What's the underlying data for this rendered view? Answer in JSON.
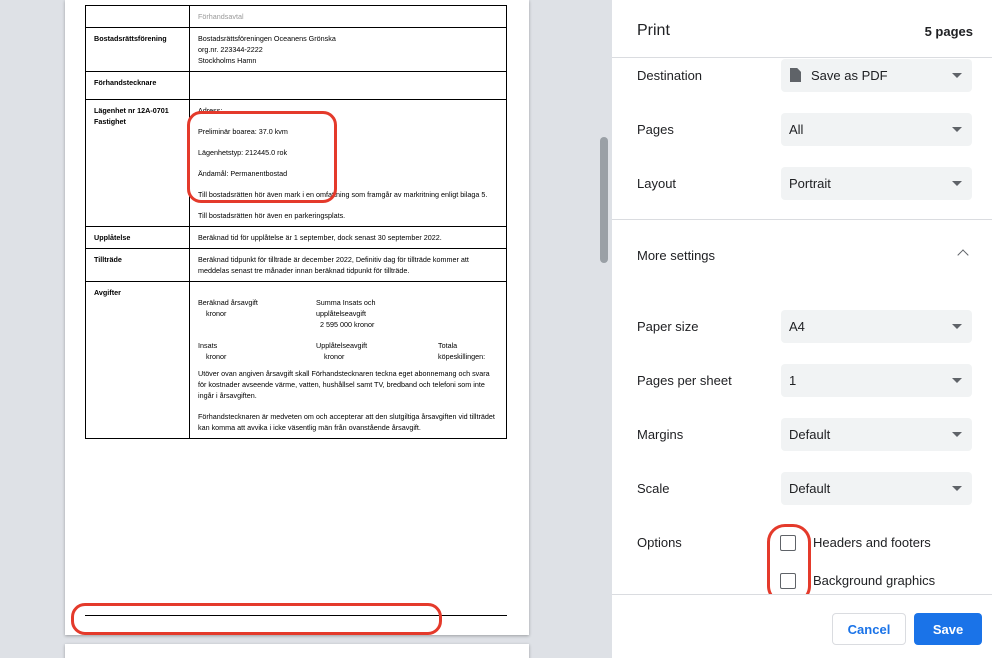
{
  "document": {
    "header_note": "Förhandsavtal",
    "rows": {
      "association": {
        "label": "Bostadsrättsförening",
        "line1": "Bostadsrättsföreningen Oceanens Grönska",
        "line2": "org.nr. 223344-2222",
        "line3": "Stockholms Hamn"
      },
      "subscriber": {
        "label": "Förhandstecknare"
      },
      "apartment": {
        "label1": "Lägenhet nr 12A-0701",
        "label2": "Fastighet",
        "address": "Adress:",
        "area": "Preliminär boarea:   37.0   kvm",
        "type": "Lägenhetstyp:   212445.0   rok",
        "purpose": "Ändamål: Permanentbostad",
        "land_note": "Till bostadsrätten hör även mark i en omfattning som framgår av markritning enligt bilaga 5.",
        "parking_note": "Till bostadsrätten hör även en parkeringsplats."
      },
      "grant": {
        "label": "Upplåtelse",
        "text": "Beräknad tid för upplåtelse är 1 september, dock senast 30 september 2022."
      },
      "access": {
        "label": "Tillträde",
        "text": "Beräknad tidpunkt för tillträde är december 2022, Definitiv dag för tillträde kommer att meddelas senast tre månader innan beräknad tidpunkt för tillträde."
      },
      "fees": {
        "label": "Avgifter",
        "annual_fee": "Beräknad årsavgift",
        "annual_fee_unit": "kronor",
        "sum_insats_1": "Summa Insats och",
        "sum_insats_2": "upplåtelseavgift",
        "sum_insats_value": "2 595 000  kronor",
        "insats": "Insats",
        "insats_unit": "kronor",
        "grant_fee": "Upplåtelseavgift",
        "grant_fee_unit": "kronor",
        "total_1": "Totala",
        "total_2": "köpeskillingen:",
        "para1": "Utöver ovan angiven årsavgift skall Förhandstecknaren teckna eget abonnemang och svara för kostnader avseende värme, vatten, hushållsel samt TV, bredband och telefoni som inte ingår i årsavgiften.",
        "para2": "Förhandstecknaren är medveten om och accepterar att den slutgiltiga årsavgiften vid tillträdet kan komma att avvika i icke väsentlig män från ovanstående årsavgift."
      }
    }
  },
  "panel": {
    "title": "Print",
    "page_count": "5 pages",
    "destination": {
      "label": "Destination",
      "value": "Save as PDF",
      "icon": "document-icon"
    },
    "pages": {
      "label": "Pages",
      "value": "All"
    },
    "layout": {
      "label": "Layout",
      "value": "Portrait"
    },
    "more_settings": {
      "label": "More settings",
      "expanded": true
    },
    "paper_size": {
      "label": "Paper size",
      "value": "A4"
    },
    "pages_per_sheet": {
      "label": "Pages per sheet",
      "value": "1"
    },
    "margins": {
      "label": "Margins",
      "value": "Default"
    },
    "scale": {
      "label": "Scale",
      "value": "Default"
    },
    "options": {
      "label": "Options",
      "headers_footers": {
        "label": "Headers and footers",
        "checked": false
      },
      "background_graphics": {
        "label": "Background graphics",
        "checked": false
      }
    },
    "cancel_label": "Cancel",
    "save_label": "Save"
  },
  "colors": {
    "accent": "#1a73e8",
    "annotation": "#e43a2b",
    "preview_background": "#dee1e6"
  }
}
